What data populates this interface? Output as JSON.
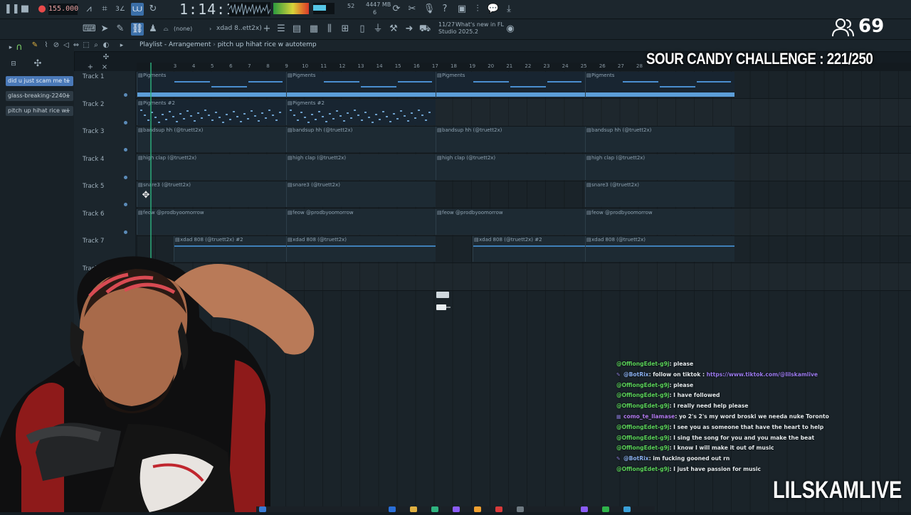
{
  "toolbar": {
    "tempo": "155.000",
    "clock": "1:14:10",
    "cpu_text": "52",
    "mem_text": "4447 MB",
    "mem_sub": "6",
    "snap_text": "(none)",
    "pattern_text": "xdad 8..ett2x)",
    "news_date": "11/27",
    "news_text": "What's new in FL",
    "news_text2": "Studio 2025.2"
  },
  "browser": {
    "items": [
      {
        "label": "did u just scam me t..",
        "selected": true
      },
      {
        "label": "glass-breaking-2240..",
        "selected": false
      },
      {
        "label": "pitch up hihat rice w..",
        "selected": false
      }
    ]
  },
  "playlist": {
    "title": "Playlist - Arrangement",
    "pattern": "pitch up hihat rice w autotemp",
    "ruler": [
      "3",
      "4",
      "5",
      "6",
      "7",
      "8",
      "9",
      "10",
      "11",
      "12",
      "13",
      "14",
      "15",
      "16",
      "17",
      "18",
      "19",
      "20",
      "21",
      "22",
      "23",
      "24",
      "25",
      "26",
      "27",
      "28"
    ],
    "tracks": [
      "Track 1",
      "Track 2",
      "Track 3",
      "Track 4",
      "Track 5",
      "Track 6",
      "Track 7",
      "Track 8"
    ],
    "clips": [
      {
        "track": 0,
        "start": 0,
        "end": 210,
        "name": "Pigments"
      },
      {
        "track": 0,
        "start": 210,
        "end": 420,
        "name": "Pigments"
      },
      {
        "track": 0,
        "start": 420,
        "end": 630,
        "name": "Pigments"
      },
      {
        "track": 0,
        "start": 630,
        "end": 840,
        "name": "Pigments"
      },
      {
        "track": 1,
        "start": 0,
        "end": 210,
        "name": "Pigments #2"
      },
      {
        "track": 1,
        "start": 210,
        "end": 420,
        "name": "Pigments #2"
      },
      {
        "track": 2,
        "start": 0,
        "end": 210,
        "name": "bandsup hh (@truett2x)"
      },
      {
        "track": 2,
        "start": 210,
        "end": 420,
        "name": "bandsup hh (@truett2x)"
      },
      {
        "track": 2,
        "start": 420,
        "end": 630,
        "name": "bandsup hh (@truett2x)"
      },
      {
        "track": 2,
        "start": 630,
        "end": 840,
        "name": "bandsup hh (@truett2x)"
      },
      {
        "track": 3,
        "start": 0,
        "end": 210,
        "name": "high clap (@truett2x)"
      },
      {
        "track": 3,
        "start": 210,
        "end": 420,
        "name": "high clap (@truett2x)"
      },
      {
        "track": 3,
        "start": 420,
        "end": 630,
        "name": "high clap (@truett2x)"
      },
      {
        "track": 3,
        "start": 630,
        "end": 840,
        "name": "high clap (@truett2x)"
      },
      {
        "track": 4,
        "start": 0,
        "end": 210,
        "name": "snare3 (@truett2x)"
      },
      {
        "track": 4,
        "start": 210,
        "end": 420,
        "name": "snare3 (@truett2x)"
      },
      {
        "track": 4,
        "start": 630,
        "end": 840,
        "name": "snare3 (@truett2x)"
      },
      {
        "track": 5,
        "start": 0,
        "end": 210,
        "name": "feow @prodbyoomorrow"
      },
      {
        "track": 5,
        "start": 210,
        "end": 420,
        "name": "feow @prodbyoomorrow"
      },
      {
        "track": 5,
        "start": 420,
        "end": 630,
        "name": "feow @prodbyoomorrow"
      },
      {
        "track": 5,
        "start": 630,
        "end": 840,
        "name": "feow @prodbyoomorrow"
      },
      {
        "track": 6,
        "start": 52,
        "end": 210,
        "name": "xdad 808 (@truett2x) #2"
      },
      {
        "track": 6,
        "start": 210,
        "end": 420,
        "name": "xdad 808 (@truett2x)"
      },
      {
        "track": 6,
        "start": 472,
        "end": 630,
        "name": "xdad 808 (@truett2x) #2"
      },
      {
        "track": 6,
        "start": 630,
        "end": 840,
        "name": "xdad 808 (@truett2x)"
      }
    ]
  },
  "overlay": {
    "viewer_count": "69",
    "challenge": "SOUR CANDY CHALLENGE : 221/250",
    "brand": "LILSKAMLIVE"
  },
  "chat": [
    {
      "user": "@OffiongEdet-g9j",
      "kind": "user",
      "msg": ": please"
    },
    {
      "user": "@BotRix",
      "kind": "bot",
      "msg": ": follow on tiktok : ",
      "link": "https://www.tiktok.com/@lilskamlive"
    },
    {
      "user": "@OffiongEdet-g9j",
      "kind": "user",
      "msg": ": please"
    },
    {
      "user": "@OffiongEdet-g9j",
      "kind": "user",
      "msg": ": I have followed"
    },
    {
      "user": "@OffiongEdet-g9j",
      "kind": "user",
      "msg": ": I really need help please"
    },
    {
      "user": "como_te_llamase",
      "kind": "como",
      "msg": ": yo 2's 2's my word broski we needa nuke Toronto"
    },
    {
      "user": "@OffiongEdet-g9j",
      "kind": "user",
      "msg": ": I see you as someone that have the heart to help"
    },
    {
      "user": "@OffiongEdet-g9j",
      "kind": "user",
      "msg": ": I sing the song for you and you make the beat"
    },
    {
      "user": "@OffiongEdet-g9j",
      "kind": "user",
      "msg": ": I know I will make it out of music"
    },
    {
      "user": "@BotRix",
      "kind": "bot",
      "msg": ": im fucking gooned out rn"
    },
    {
      "user": "@OffiongEdet-g9j",
      "kind": "user",
      "msg": ": I just have passion for music"
    }
  ]
}
